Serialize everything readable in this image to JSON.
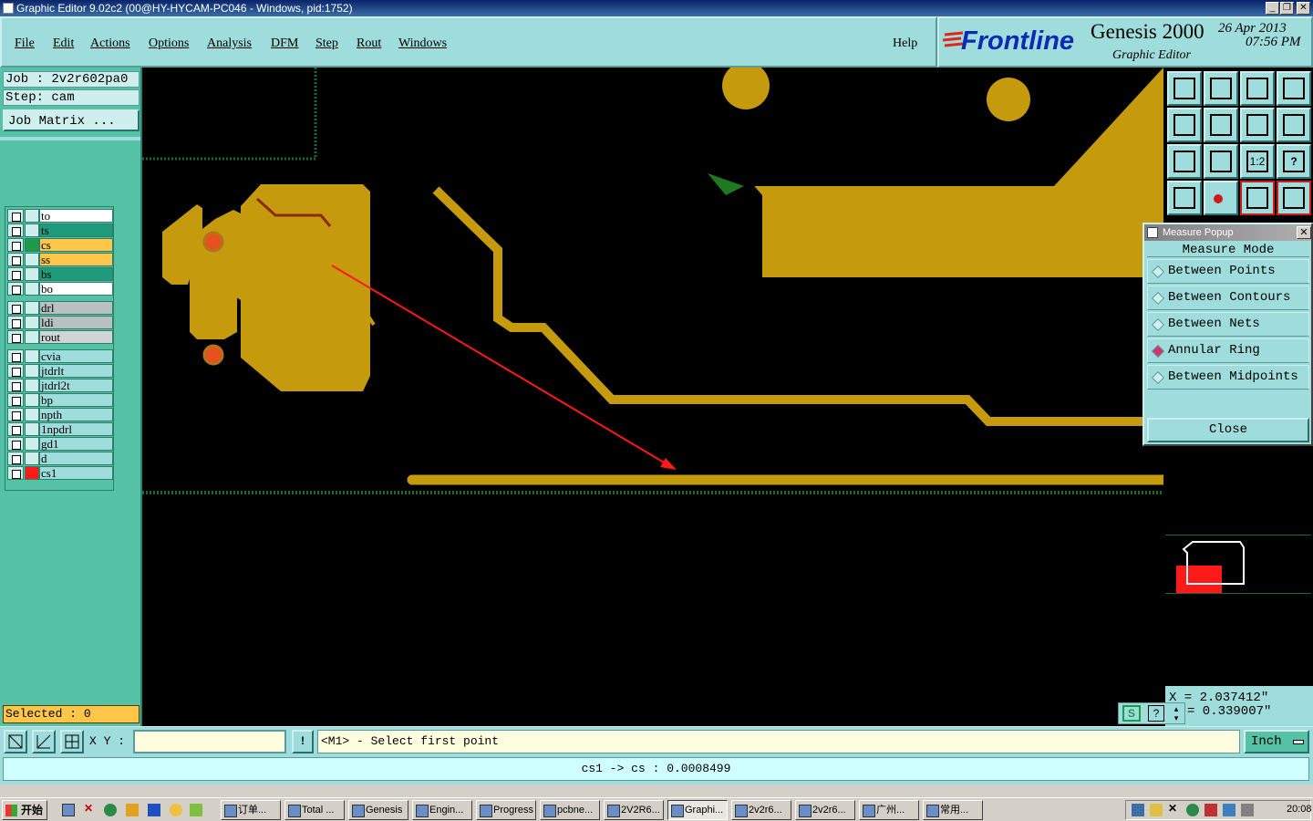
{
  "window": {
    "title": "Graphic Editor 9.02c2 (00@HY-HYCAM-PC046 - Windows, pid:1752)"
  },
  "menus": [
    "File",
    "Edit",
    "Actions",
    "Options",
    "Analysis",
    "DFM",
    "Step",
    "Rout",
    "Windows",
    "Help"
  ],
  "brand": {
    "logo": "Frontline",
    "product": "Genesis 2000",
    "subtitle": "Graphic Editor",
    "date": "26 Apr 2013",
    "time": "07:56 PM"
  },
  "job": {
    "job_label": "Job : 2v2r602pa0",
    "step_label": "Step: cam",
    "matrix_button": "Job Matrix ..."
  },
  "layers": [
    {
      "name": "to",
      "color": "#ffffff",
      "mark": "#cfeeee"
    },
    {
      "name": "ts",
      "color": "#1f9a7a",
      "mark": "#cfeeee"
    },
    {
      "name": "cs",
      "color": "#ffc64a",
      "mark": "#1f9a4a"
    },
    {
      "name": "ss",
      "color": "#ffc64a",
      "mark": "#cfeeee"
    },
    {
      "name": "bs",
      "color": "#1f9a7a",
      "mark": "#cfeeee"
    },
    {
      "name": "bo",
      "color": "#ffffff",
      "mark": "#cfeeee"
    },
    {
      "name": "drl",
      "color": "#b8c0c0",
      "mark": "#cfeeee"
    },
    {
      "name": "ldi",
      "color": "#b8c0c0",
      "mark": "#cfeeee"
    },
    {
      "name": "rout",
      "color": "#d0d4d4",
      "mark": "#cfeeee"
    },
    {
      "name": "cvia",
      "color": "#9fdcdc",
      "mark": "#cfeeee"
    },
    {
      "name": "jtdrlt",
      "color": "#9fdcdc",
      "mark": "#cfeeee"
    },
    {
      "name": "jtdrl2t",
      "color": "#9fdcdc",
      "mark": "#cfeeee"
    },
    {
      "name": "bp",
      "color": "#9fdcdc",
      "mark": "#cfeeee"
    },
    {
      "name": "npth",
      "color": "#9fdcdc",
      "mark": "#cfeeee"
    },
    {
      "name": "1npdrl",
      "color": "#9fdcdc",
      "mark": "#cfeeee"
    },
    {
      "name": "gd1",
      "color": "#9fdcdc",
      "mark": "#cfeeee"
    },
    {
      "name": "d",
      "color": "#9fdcdc",
      "mark": "#cfeeee"
    },
    {
      "name": "cs1",
      "color": "#9fdcdc",
      "mark": "#ff1a1a"
    }
  ],
  "selected": "Selected : 0",
  "measure_popup": {
    "title": "Measure Popup",
    "header": "Measure Mode",
    "options": [
      {
        "label": "Between Points",
        "selected": false
      },
      {
        "label": "Between Contours",
        "selected": false
      },
      {
        "label": "Between Nets",
        "selected": false
      },
      {
        "label": "Annular Ring",
        "selected": true
      },
      {
        "label": "Between Midpoints",
        "selected": false
      }
    ],
    "close": "Close"
  },
  "coords": {
    "x": "X = 2.037412\"",
    "y": "= 0.339007\""
  },
  "bottom": {
    "xy_label": "X Y :",
    "xy_value": "",
    "prompt": "<M1> - Select first point",
    "units": "Inch"
  },
  "status": {
    "message": "cs1 -> cs : 0.0008499"
  },
  "taskbar": {
    "start": "开始",
    "items": [
      "订单...",
      "Total ...",
      "Genesis",
      "Engin...",
      "Progress",
      "pcbne...",
      "2V2R6...",
      "Graphi...",
      "2v2r6...",
      "2v2r6...",
      "广州...",
      "常用..."
    ],
    "clock": "20:08"
  },
  "colors": {
    "copper": "#c59a0c",
    "pad": "#e8501e",
    "arrow": "#ff1a1a",
    "panel": "#9fdcdc",
    "left": "#55c2a5"
  }
}
